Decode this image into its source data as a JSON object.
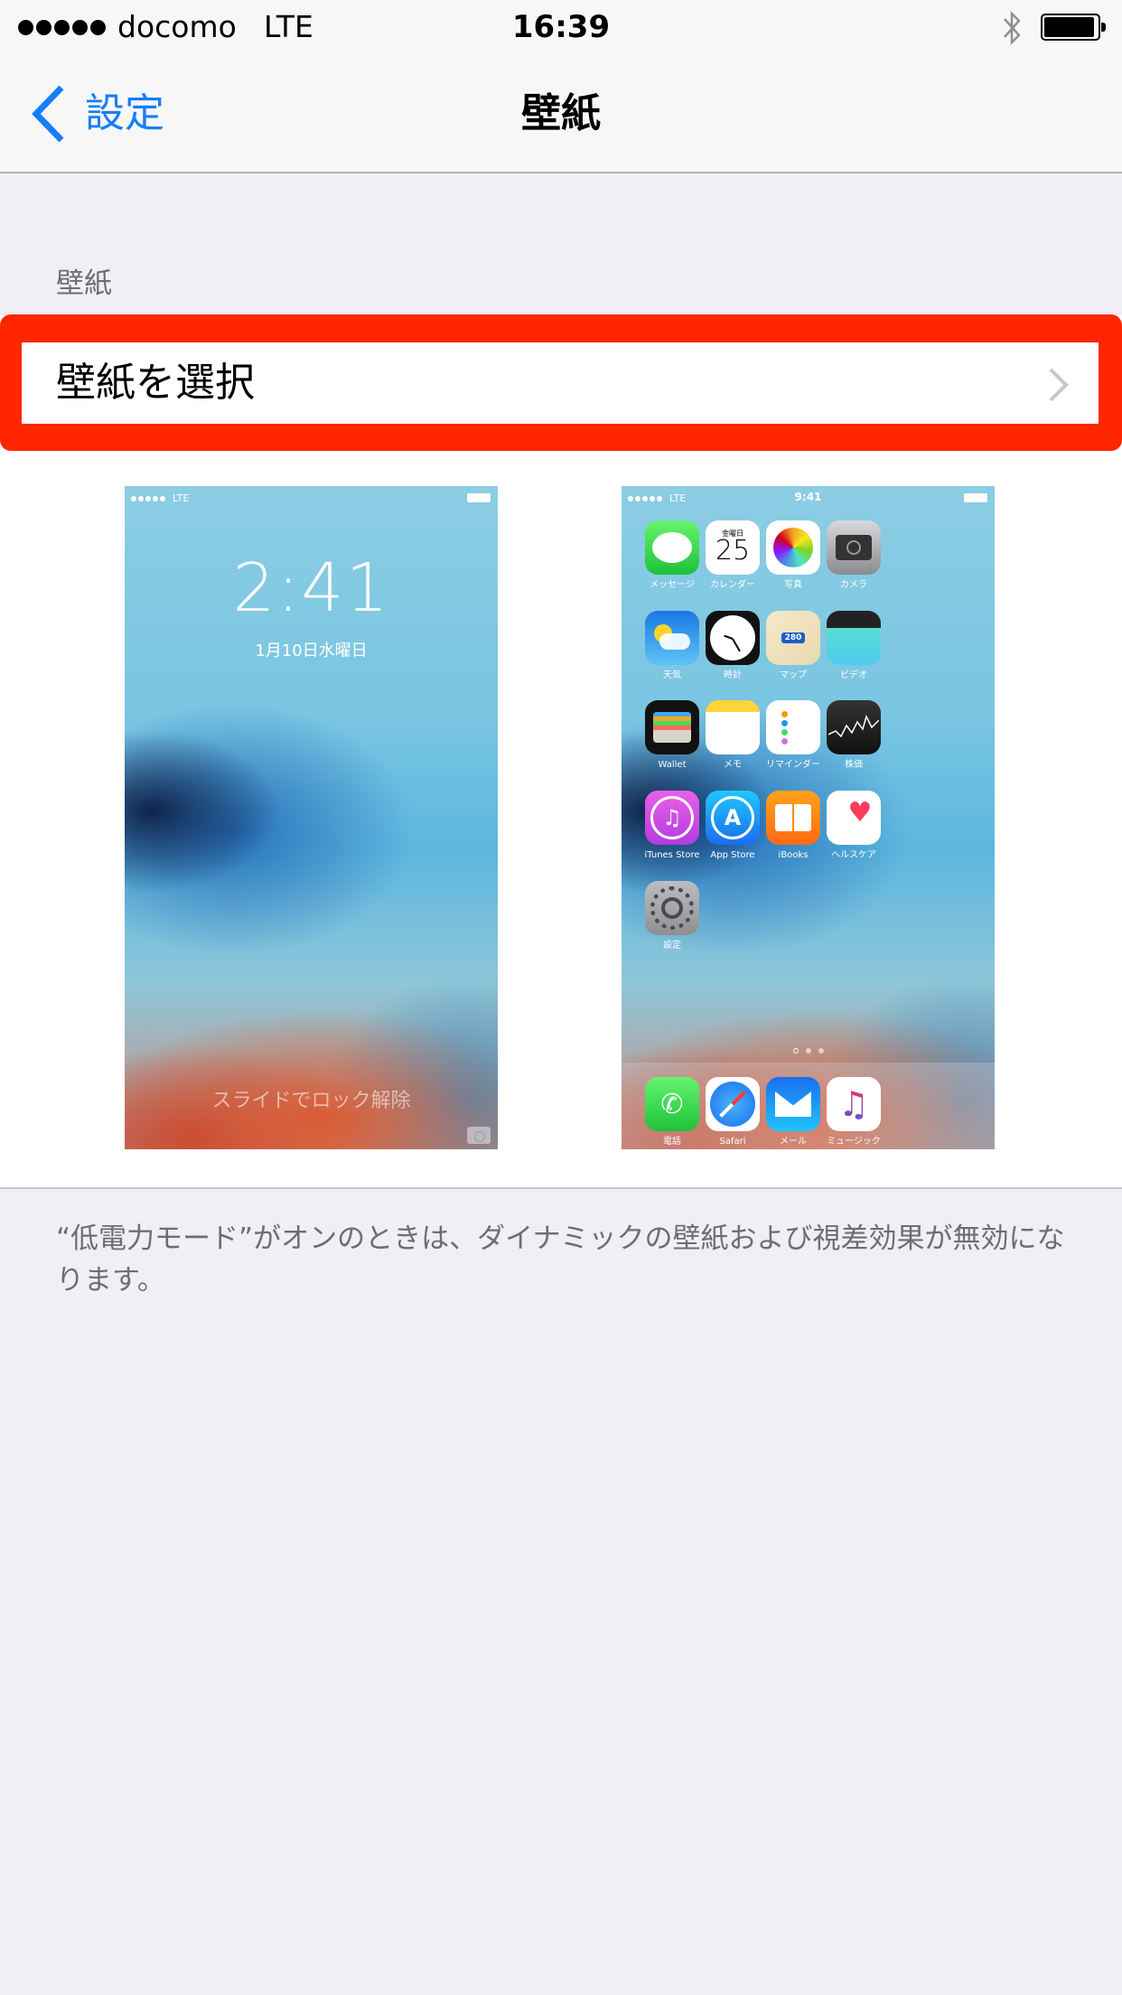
{
  "status_bar": {
    "signal_bars": 5,
    "carrier": "docomo",
    "network": "LTE",
    "time": "16:39",
    "bluetooth_icon": "bluetooth-icon",
    "battery_level": 0.95
  },
  "nav": {
    "back_label": "設定",
    "title": "壁紙"
  },
  "section": {
    "header": "壁紙",
    "row_label": "壁紙を選択",
    "highlight_color": "#ff2600"
  },
  "lock_preview": {
    "network": "LTE",
    "time": "2:41",
    "date": "1月10日水曜日",
    "slide_text": "スライドでロック解除"
  },
  "home_preview": {
    "network": "LTE",
    "time": "9:41",
    "calendar_day_label": "金曜日",
    "calendar_day": "25",
    "maps_shield": "280",
    "apps": [
      {
        "label": "メッセージ",
        "icon": "messages-icon"
      },
      {
        "label": "カレンダー",
        "icon": "calendar-icon"
      },
      {
        "label": "写真",
        "icon": "photos-icon"
      },
      {
        "label": "カメラ",
        "icon": "camera-icon"
      },
      {
        "label": "天気",
        "icon": "weather-icon"
      },
      {
        "label": "時計",
        "icon": "clock-icon"
      },
      {
        "label": "マップ",
        "icon": "maps-icon"
      },
      {
        "label": "ビデオ",
        "icon": "videos-icon"
      },
      {
        "label": "Wallet",
        "icon": "wallet-icon"
      },
      {
        "label": "メモ",
        "icon": "notes-icon"
      },
      {
        "label": "リマインダー",
        "icon": "reminders-icon"
      },
      {
        "label": "株価",
        "icon": "stocks-icon"
      },
      {
        "label": "iTunes Store",
        "icon": "itunes-store-icon"
      },
      {
        "label": "App Store",
        "icon": "app-store-icon"
      },
      {
        "label": "iBooks",
        "icon": "ibooks-icon"
      },
      {
        "label": "ヘルスケア",
        "icon": "health-icon"
      },
      {
        "label": "設定",
        "icon": "settings-icon"
      }
    ],
    "dock": [
      {
        "label": "電話",
        "icon": "phone-icon"
      },
      {
        "label": "Safari",
        "icon": "safari-icon"
      },
      {
        "label": "メール",
        "icon": "mail-icon"
      },
      {
        "label": "ミュージック",
        "icon": "music-icon"
      }
    ]
  },
  "footer_note": "“低電力モード”がオンのときは、ダイナミックの壁紙および視差効果が無効になります。"
}
